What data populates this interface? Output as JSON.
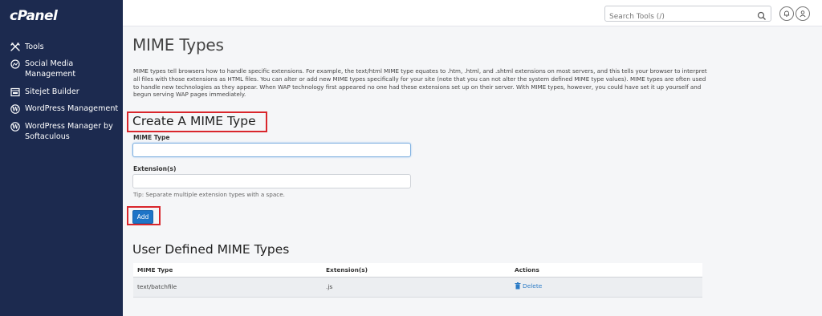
{
  "sidebar": {
    "logo": "cPanel",
    "items": [
      {
        "icon": "tools-icon",
        "label": "Tools"
      },
      {
        "icon": "social-media-icon",
        "label": "Social Media Management"
      },
      {
        "icon": "sitejet-icon",
        "label": "Sitejet Builder"
      },
      {
        "icon": "wordpress-icon",
        "label": "WordPress Management"
      },
      {
        "icon": "wordpress-icon",
        "label": "WordPress Manager by Softaculous"
      }
    ]
  },
  "topbar": {
    "search_placeholder": "Search Tools (/)",
    "search_icon": "search-icon",
    "notifications_icon": "bell-icon",
    "user_icon": "user-icon"
  },
  "main": {
    "title": "MIME Types",
    "description": "MIME types tell browsers how to handle specific extensions. For example, the text/html MIME type equates to .htm, .html, and .shtml extensions on most servers, and this tells your browser to interpret all files with those extensions as HTML files. You can alter or add new MIME types specifically for your site (note that you can not alter the system defined MIME type values). MIME types are often used to handle new technologies as they appear. When WAP technology first appeared no one had these extensions set up on their server. With MIME types, however, you could have set it up yourself and begun serving WAP pages immediately.",
    "create_title": "Create A MIME Type",
    "mime_type_label": "MIME Type",
    "mime_type_value": "",
    "extensions_label": "Extension(s)",
    "extensions_value": "",
    "tip": "Tip: Separate multiple extension types with a space.",
    "add_button": "Add",
    "user_defined_title": "User Defined MIME Types",
    "table": {
      "headers": [
        "MIME Type",
        "Extension(s)",
        "Actions"
      ],
      "rows": [
        {
          "mime_type": "text/batchfile",
          "extensions": ".js",
          "action": "Delete"
        }
      ]
    }
  },
  "colors": {
    "sidebar_bg": "#1c2a4f",
    "accent": "#1e74c7",
    "highlight_box": "#d9262c"
  }
}
